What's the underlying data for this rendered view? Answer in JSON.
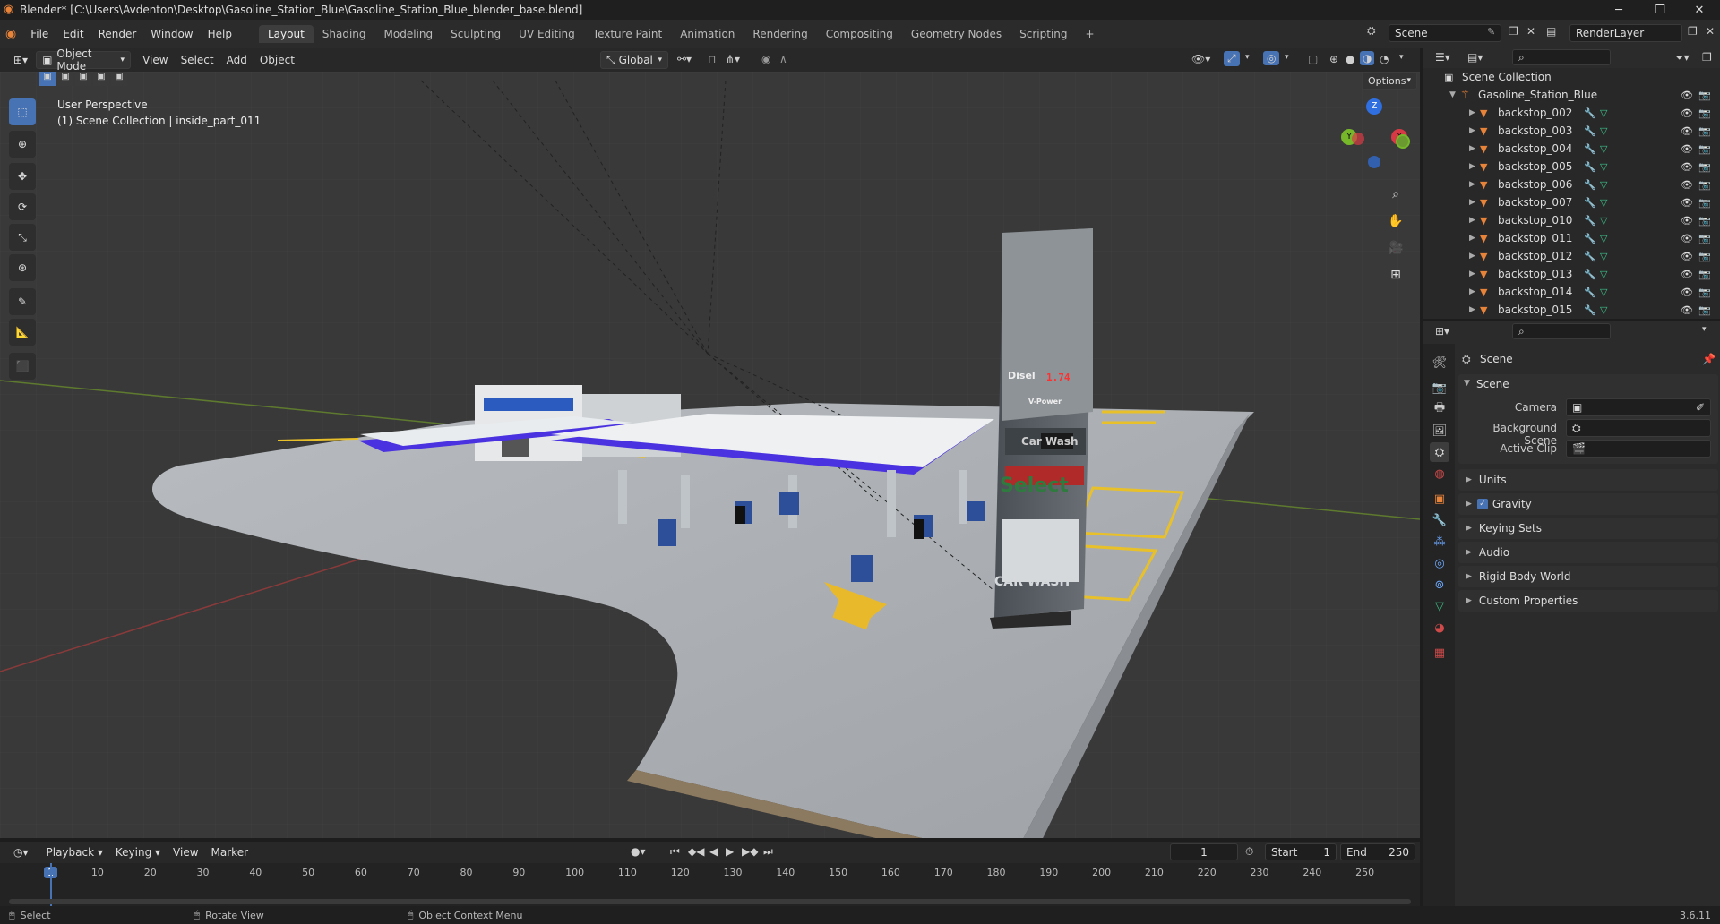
{
  "window": {
    "title": "Blender* [C:\\Users\\Avdenton\\Desktop\\Gasoline_Station_Blue\\Gasoline_Station_Blue_blender_base.blend]",
    "minimize": "─",
    "maximize": "❐",
    "close": "✕"
  },
  "menus": [
    "File",
    "Edit",
    "Render",
    "Window",
    "Help"
  ],
  "workspaces": [
    "Layout",
    "Shading",
    "Modeling",
    "Sculpting",
    "UV Editing",
    "Texture Paint",
    "Animation",
    "Rendering",
    "Compositing",
    "Geometry Nodes",
    "Scripting"
  ],
  "add_tab": "+",
  "scene_field": "Scene",
  "render_layer": "RenderLayer",
  "viewport_header": {
    "mode": "Object Mode",
    "view": "View",
    "select": "Select",
    "add": "Add",
    "object": "Object",
    "orientation": "Global",
    "options": "Options"
  },
  "viewport": {
    "perspective": "User Perspective",
    "collection": "(1) Scene Collection | inside_part_011"
  },
  "sign": {
    "disel": "Disel",
    "price": "1.74",
    "vpower": "V-Power",
    "carwash1": "Car Wash",
    "select": "Select",
    "carwash2": "CAR WASH"
  },
  "gizmo": {
    "z": "Z",
    "y": "Y",
    "x": "X"
  },
  "outliner": {
    "root": "Scene Collection",
    "collection": "Gasoline_Station_Blue",
    "items": [
      "backstop_002",
      "backstop_003",
      "backstop_004",
      "backstop_005",
      "backstop_006",
      "backstop_007",
      "backstop_010",
      "backstop_011",
      "backstop_012",
      "backstop_013",
      "backstop_014",
      "backstop_015"
    ]
  },
  "properties": {
    "header": "Scene",
    "section": "Scene",
    "camera_label": "Camera",
    "bg_scene_label": "Background Scene",
    "active_clip_label": "Active Clip",
    "panels": [
      "Units",
      "Gravity",
      "Keying Sets",
      "Audio",
      "Rigid Body World",
      "Custom Properties"
    ]
  },
  "timeline": {
    "playback": "Playback",
    "keying": "Keying",
    "view": "View",
    "marker": "Marker",
    "current_frame": "1",
    "start_label": "Start",
    "start": "1",
    "end_label": "End",
    "end": "250",
    "ticks": [
      "1",
      "10",
      "20",
      "30",
      "40",
      "50",
      "60",
      "70",
      "80",
      "90",
      "100",
      "110",
      "120",
      "130",
      "140",
      "150",
      "160",
      "170",
      "180",
      "190",
      "200",
      "210",
      "220",
      "230",
      "240",
      "250"
    ]
  },
  "status": {
    "select": "Select",
    "rotate": "Rotate View",
    "context": "Object Context Menu",
    "version": "3.6.11"
  },
  "colors": {
    "accent": "#4772b3",
    "canopy_blue": "#4a32e0",
    "object_orange": "#e8833a",
    "mesh_green": "#3dc08a"
  }
}
